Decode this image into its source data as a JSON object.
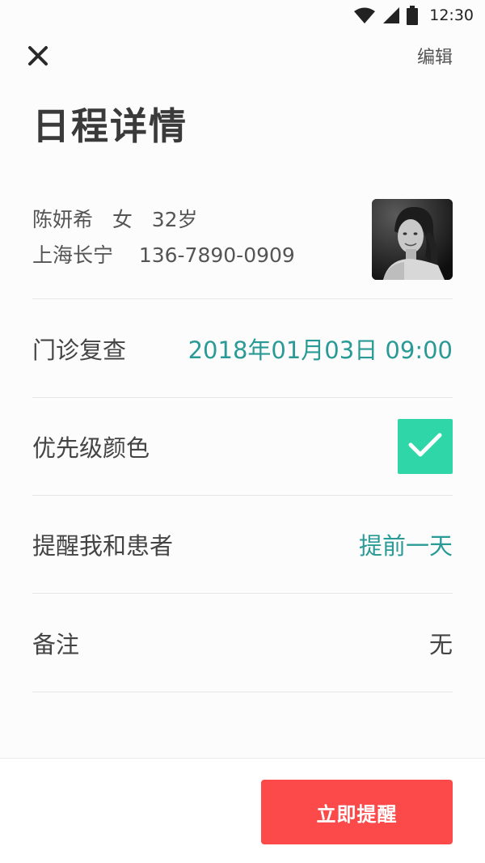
{
  "status_bar": {
    "time": "12:30",
    "icons": [
      "wifi-icon",
      "cellular-signal-icon",
      "battery-icon"
    ]
  },
  "top_bar": {
    "close_icon": "close-icon",
    "edit_label": "编辑"
  },
  "page": {
    "title": "日程详情"
  },
  "patient": {
    "name": "陈妍希",
    "gender": "女",
    "age": "32岁",
    "location": "上海长宁",
    "phone": "136-7890-0909"
  },
  "rows": {
    "appointment": {
      "label": "门诊复查",
      "value": "2018年01月03日 09:00"
    },
    "priority": {
      "label": "优先级颜色",
      "color": "#2fd6a8",
      "checked": true
    },
    "reminder": {
      "label": "提醒我和患者",
      "value": "提前一天"
    },
    "note": {
      "label": "备注",
      "value": "无"
    }
  },
  "actions": {
    "remind_now": "立即提醒"
  },
  "colors": {
    "accent_teal": "#2a9a96",
    "priority_green": "#2fd6a8",
    "button_red": "#fc4a4a"
  }
}
